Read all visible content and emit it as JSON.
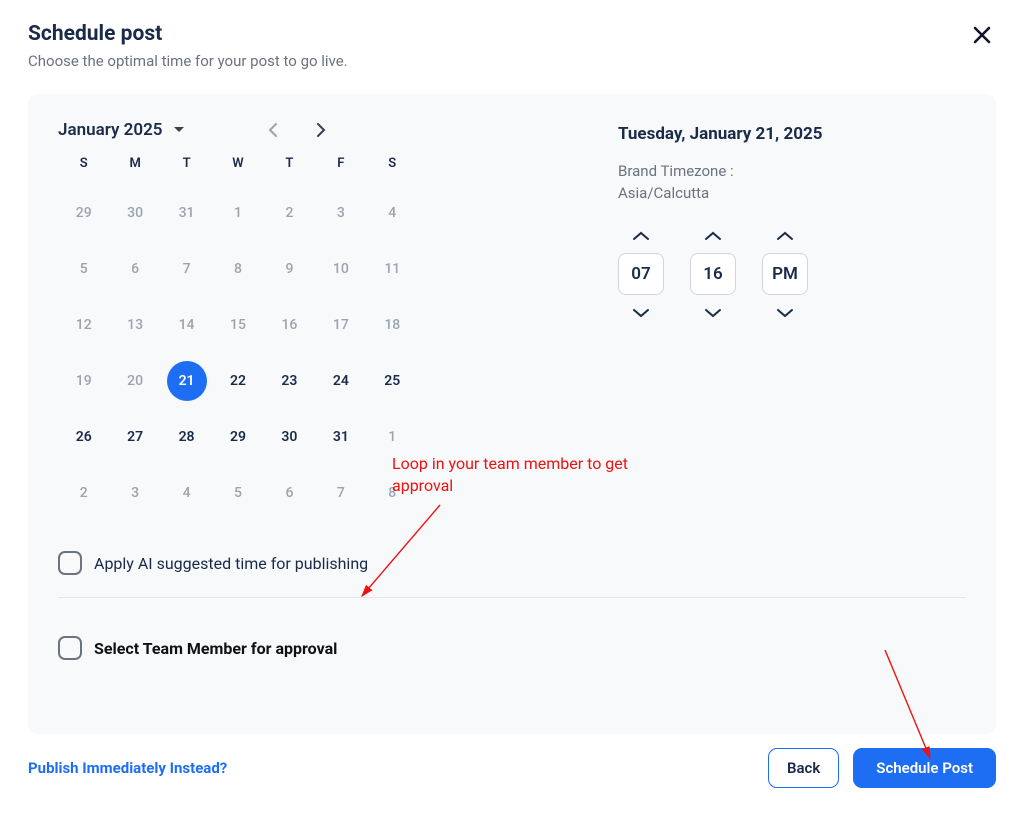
{
  "header": {
    "title": "Schedule post",
    "subtitle": "Choose the optimal time for your post to go live."
  },
  "calendar": {
    "month_label": "January 2025",
    "dow": [
      "S",
      "M",
      "T",
      "W",
      "T",
      "F",
      "S"
    ],
    "weeks": [
      [
        {
          "n": "29",
          "m": true
        },
        {
          "n": "30",
          "m": true
        },
        {
          "n": "31",
          "m": true
        },
        {
          "n": "1",
          "m": true
        },
        {
          "n": "2",
          "m": true
        },
        {
          "n": "3",
          "m": true
        },
        {
          "n": "4",
          "m": true
        }
      ],
      [
        {
          "n": "5",
          "m": true
        },
        {
          "n": "6",
          "m": true
        },
        {
          "n": "7",
          "m": true
        },
        {
          "n": "8",
          "m": true
        },
        {
          "n": "9",
          "m": true
        },
        {
          "n": "10",
          "m": true
        },
        {
          "n": "11",
          "m": true
        }
      ],
      [
        {
          "n": "12",
          "m": true
        },
        {
          "n": "13",
          "m": true
        },
        {
          "n": "14",
          "m": true
        },
        {
          "n": "15",
          "m": true
        },
        {
          "n": "16",
          "m": true
        },
        {
          "n": "17",
          "m": true
        },
        {
          "n": "18",
          "m": true
        }
      ],
      [
        {
          "n": "19",
          "m": true
        },
        {
          "n": "20",
          "m": true
        },
        {
          "n": "21",
          "sel": true
        },
        {
          "n": "22"
        },
        {
          "n": "23"
        },
        {
          "n": "24"
        },
        {
          "n": "25"
        }
      ],
      [
        {
          "n": "26"
        },
        {
          "n": "27"
        },
        {
          "n": "28"
        },
        {
          "n": "29"
        },
        {
          "n": "30"
        },
        {
          "n": "31"
        },
        {
          "n": "1",
          "m": true
        }
      ],
      [
        {
          "n": "2",
          "m": true
        },
        {
          "n": "3",
          "m": true
        },
        {
          "n": "4",
          "m": true
        },
        {
          "n": "5",
          "m": true
        },
        {
          "n": "6",
          "m": true
        },
        {
          "n": "7",
          "m": true
        },
        {
          "n": "8",
          "m": true
        }
      ]
    ]
  },
  "selected": {
    "date_label": "Tuesday, January 21, 2025",
    "tz_label": "Brand Timezone :",
    "tz_value": "Asia/Calcutta",
    "hour": "07",
    "minute": "16",
    "ampm": "PM"
  },
  "options": {
    "ai_label": "Apply AI suggested time for publishing",
    "approval_label": "Select Team Member for approval"
  },
  "footer": {
    "publish_link": "Publish Immediately Instead?",
    "back": "Back",
    "schedule": "Schedule Post"
  },
  "annotations": {
    "note1": "Loop in your team member to get\napproval"
  }
}
